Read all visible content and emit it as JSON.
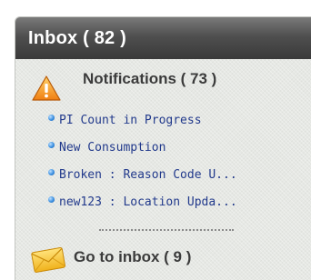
{
  "panel": {
    "title": "Inbox ( 82 )"
  },
  "notifications": {
    "title": "Notifications ( 73 )",
    "items": [
      {
        "label": "PI Count in Progress"
      },
      {
        "label": "New Consumption"
      },
      {
        "label": "Broken : Reason Code U..."
      },
      {
        "label": "new123 : Location Upda..."
      }
    ]
  },
  "goto_inbox": {
    "label": "Go to inbox ( 9 )"
  },
  "icons": {
    "warning": "warning-triangle-icon",
    "bullet": "blue-dot-icon",
    "mail": "envelope-icon"
  },
  "colors": {
    "header_bg": "#4a4a4a",
    "link_text": "#223a8c",
    "bullet": "#3a8fe0",
    "warning_fill": "#f39a1e"
  }
}
